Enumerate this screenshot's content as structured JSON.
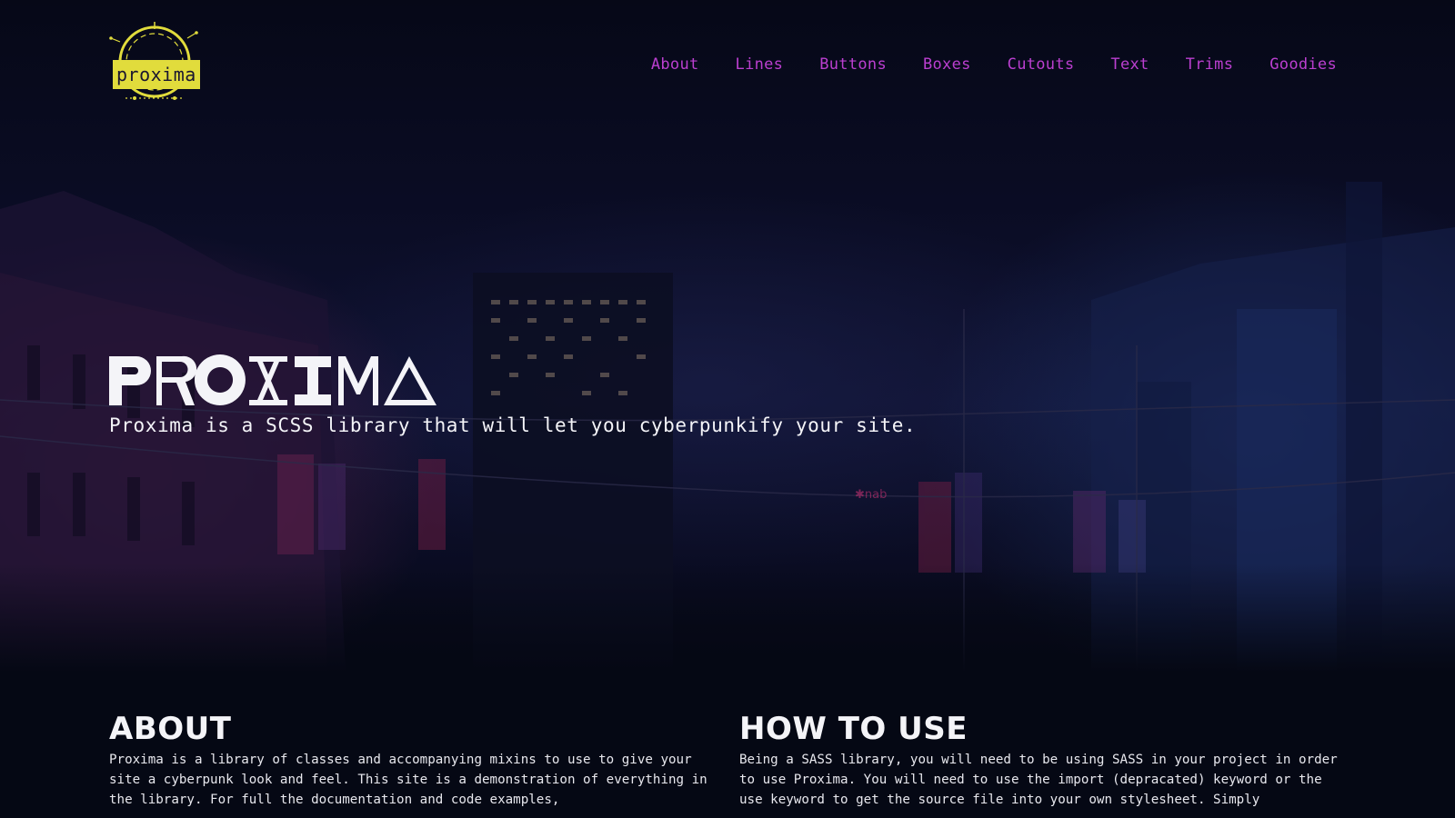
{
  "logo": {
    "text": "proxima"
  },
  "nav": {
    "items": [
      {
        "label": "About"
      },
      {
        "label": "Lines"
      },
      {
        "label": "Buttons"
      },
      {
        "label": "Boxes"
      },
      {
        "label": "Cutouts"
      },
      {
        "label": "Text"
      },
      {
        "label": "Trims"
      },
      {
        "label": "Goodies"
      }
    ]
  },
  "hero": {
    "title": "PROXIMA",
    "tagline": "Proxima is a SCSS library that will let you cyberpunkify your site."
  },
  "about": {
    "heading": "ABOUT",
    "body": "Proxima is a library of classes and accompanying mixins to use to give your site a cyberpunk look and feel. This site is a demonstration of everything in the library. For full the documentation and code examples,"
  },
  "howto": {
    "heading": "HOW TO USE",
    "body": "Being a SASS library, you will need to be using SASS in your project in order to use Proxima. You will need to use the import (depracated) keyword or the use keyword to get the source file into your own stylesheet. Simply"
  },
  "colors": {
    "background": "#050814",
    "nav_link": "#bb3fd0",
    "logo_accent": "#e1dc3c",
    "text": "#f4f4f8"
  }
}
